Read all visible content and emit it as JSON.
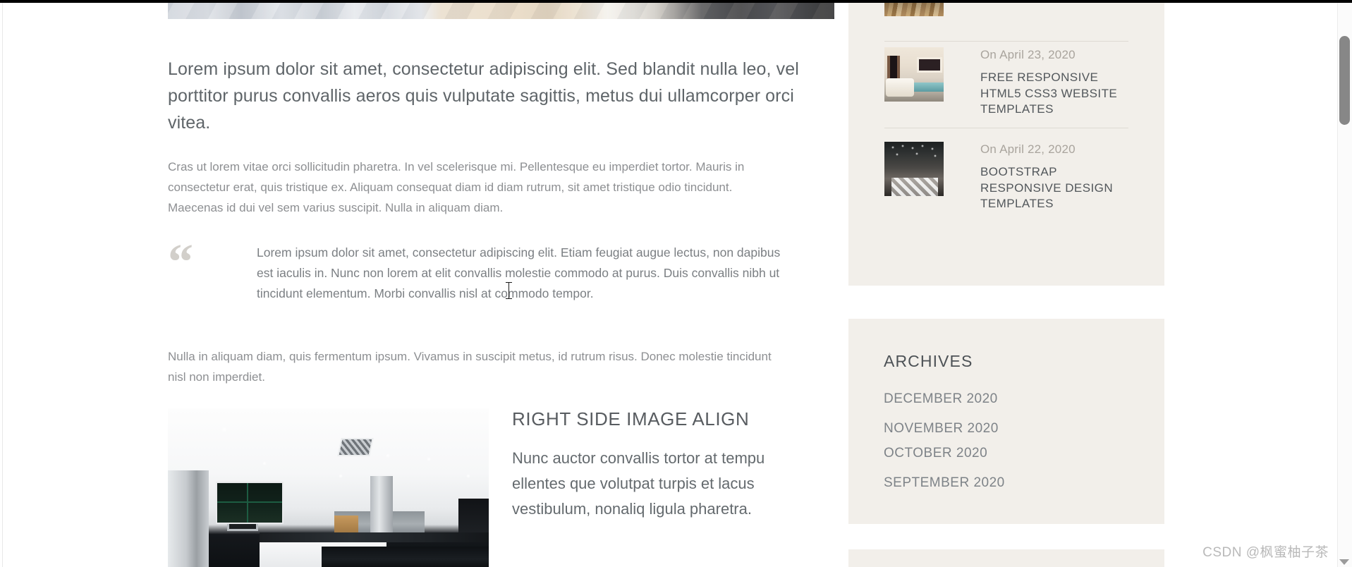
{
  "article": {
    "lead_paragraph": "Lorem ipsum dolor sit amet, consectetur adipiscing elit. Sed blandit nulla leo, vel porttitor purus convallis aeros quis vulputate sagittis, metus dui ullamcorper orci vitea.",
    "body_paragraph": "Cras ut lorem vitae orci sollicitudin pharetra. In vel scelerisque mi. Pellentesque eu imperdiet tortor. Mauris in consectetur erat, quis tristique ex. Aliquam consequat diam id diam rutrum, sit amet tristique odio tincidunt. Maecenas id dui vel sem varius suscipit. Nulla in aliquam diam.",
    "blockquote": {
      "mark": "“",
      "text": "Lorem ipsum dolor sit amet, consectetur adipiscing elit. Etiam feugiat augue lectus, non dapibus est iaculis in. Nunc non lorem at elit convallis molestie commodo at purus. Duis convallis nibh ut tincidunt elementum. Morbi convallis nisl at commodo tempor."
    },
    "post_quote_paragraph": "Nulla in aliquam diam, quis fermentum ipsum. Vivamus in suscipit metus, id rutrum risus. Donec molestie tincidunt nisl non imperdiet.",
    "align_block": {
      "title": "RIGHT SIDE IMAGE ALIGN",
      "text": "Nunc auctor convallis tortor at tempu ellentes que volutpat turpis et lacus vestibulum, nonaliq ligula pharetra.",
      "image_alt": "modern-white-kitchen-photo"
    },
    "hero_image_alt": "bedroom-interior-photo"
  },
  "sidebar": {
    "recent_posts": {
      "items": [
        {
          "date": "On April 23, 2020",
          "title": "FREE RESPONSIVE HTML5 CSS3 WEBSITE TEMPLATES",
          "thumb_alt": "living-room-thumbnail"
        },
        {
          "date": "On April 22, 2020",
          "title": "BOOTSTRAP RESPONSIVE DESIGN TEMPLATES",
          "thumb_alt": "hotel-lobby-thumbnail"
        }
      ]
    },
    "archives": {
      "title": "ARCHIVES",
      "items": [
        "DECEMBER 2020",
        "NOVEMBER 2020",
        "OCTOBER 2020",
        "SEPTEMBER 2020"
      ]
    }
  },
  "watermark": {
    "text": "CSDN @枫蜜柚子茶"
  },
  "colors": {
    "page_background": "#ffffff",
    "sidebar_panel": "#f2efea",
    "heading_text": "#585c60",
    "body_text": "#8d8f92",
    "muted_text": "#a9a49d",
    "divider": "#dedad3",
    "quote_mark": "#d2cfca",
    "scrollbar_thumb": "#878787"
  }
}
